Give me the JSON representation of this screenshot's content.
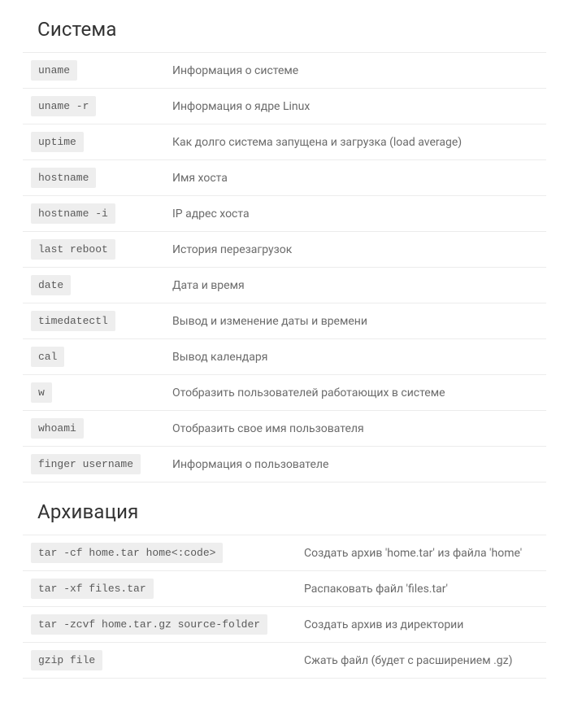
{
  "sections": [
    {
      "id": "system",
      "title": "Система",
      "cmd_col": "narrow",
      "rows": [
        {
          "cmd": "uname",
          "desc": "Информация о системе"
        },
        {
          "cmd": "uname -r",
          "desc": "Информация о ядре Linux"
        },
        {
          "cmd": "uptime",
          "desc": "Как долго система запущена и загрузка (load average)"
        },
        {
          "cmd": "hostname",
          "desc": "Имя хоста"
        },
        {
          "cmd": "hostname -i",
          "desc": "IP адрес хоста"
        },
        {
          "cmd": "last reboot",
          "desc": "История перезагрузок"
        },
        {
          "cmd": "date",
          "desc": "Дата и время"
        },
        {
          "cmd": "timedatectl",
          "desc": "Вывод и изменение даты и времени"
        },
        {
          "cmd": "cal",
          "desc": "Вывод календаря"
        },
        {
          "cmd": "w",
          "desc": "Отобразить пользователей работающих в системе"
        },
        {
          "cmd": "whoami",
          "desc": "Отобразить свое имя пользователя"
        },
        {
          "cmd": "finger username",
          "desc": "Информация о пользователе"
        }
      ]
    },
    {
      "id": "archiving",
      "title": "Архивация",
      "cmd_col": "wide",
      "rows": [
        {
          "cmd": "tar -cf home.tar home<:code>",
          "desc": "Создать архив 'home.tar' из файла 'home'"
        },
        {
          "cmd": "tar -xf files.tar",
          "desc": "Распаковать файл 'files.tar'"
        },
        {
          "cmd": "tar -zcvf home.tar.gz source-folder",
          "desc": "Создать архив из директории"
        },
        {
          "cmd": "gzip file",
          "desc": "Сжать файл (будет с расширением .gz)"
        }
      ]
    }
  ]
}
